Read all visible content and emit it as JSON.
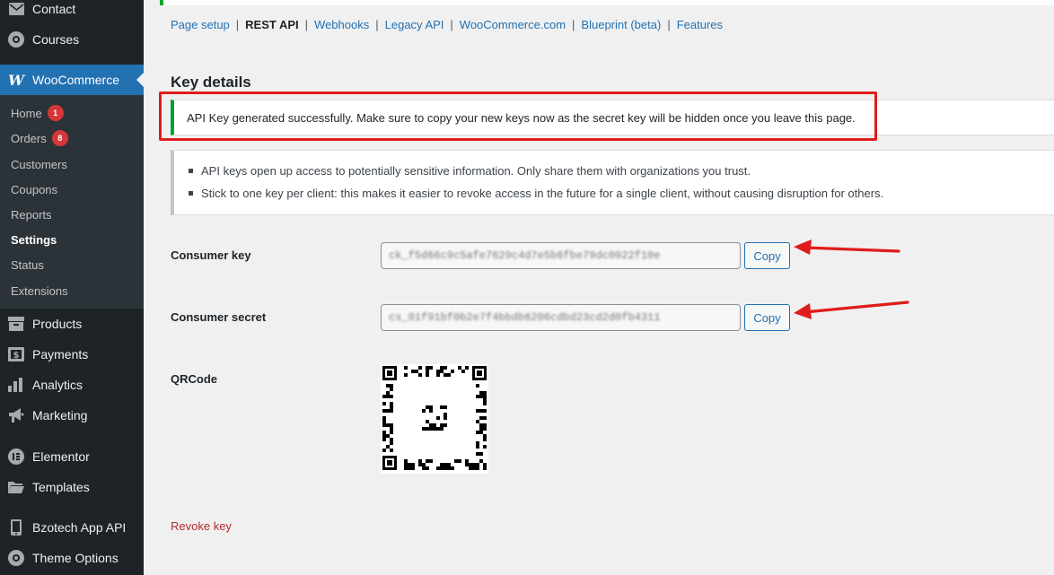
{
  "sidebar": {
    "top_items": [
      {
        "label": "Contact",
        "icon": "mail-icon"
      },
      {
        "label": "Courses",
        "icon": "gear-icon"
      }
    ],
    "woocommerce": {
      "label": "WooCommerce",
      "icon_text": "W"
    },
    "submenu": [
      {
        "label": "Home",
        "badge": "1"
      },
      {
        "label": "Orders",
        "badge": "8"
      },
      {
        "label": "Customers"
      },
      {
        "label": "Coupons"
      },
      {
        "label": "Reports"
      },
      {
        "label": "Settings",
        "current": true
      },
      {
        "label": "Status"
      },
      {
        "label": "Extensions"
      }
    ],
    "bottom_items": [
      {
        "label": "Products",
        "icon": "archive-icon"
      },
      {
        "label": "Payments",
        "icon": "payments-icon"
      },
      {
        "label": "Analytics",
        "icon": "bar-chart-icon"
      },
      {
        "label": "Marketing",
        "icon": "megaphone-icon"
      },
      {
        "label": "Elementor",
        "icon": "elementor-icon"
      },
      {
        "label": "Templates",
        "icon": "folder-icon"
      },
      {
        "label": "Bzotech App API",
        "icon": "phone-icon"
      },
      {
        "label": "Theme Options",
        "icon": "gear-icon"
      }
    ]
  },
  "subnav": {
    "tabs": [
      {
        "label": "Page setup"
      },
      {
        "label": "REST API",
        "current": true
      },
      {
        "label": "Webhooks"
      },
      {
        "label": "Legacy API"
      },
      {
        "label": "WooCommerce.com"
      },
      {
        "label": "Blueprint (beta)"
      },
      {
        "label": "Features"
      }
    ],
    "separator": "|"
  },
  "main": {
    "heading": "Key details",
    "notice": "API Key generated successfully. Make sure to copy your new keys now as the secret key will be hidden once you leave this page.",
    "info": [
      "API keys open up access to potentially sensitive information. Only share them with organizations you trust.",
      "Stick to one key per client: this makes it easier to revoke access in the future for a single client, without causing disruption for others."
    ],
    "consumer_key": {
      "label": "Consumer key",
      "value": "ck_f5d66c9c5afe7629c4d7e5b6fbe79dc0922f10e",
      "copy_label": "Copy"
    },
    "consumer_secret": {
      "label": "Consumer secret",
      "value": "cs_01f91bf0b2e7f4bbdb6206cdbd23cd2d0fb4311",
      "copy_label": "Copy"
    },
    "qr_label": "QRCode",
    "revoke_label": "Revoke key"
  },
  "colors": {
    "accent": "#2271b1",
    "success": "#00a32a",
    "highlight": "#e01b1b",
    "danger": "#b32d2e",
    "sidebar_bg": "#1d2327"
  }
}
